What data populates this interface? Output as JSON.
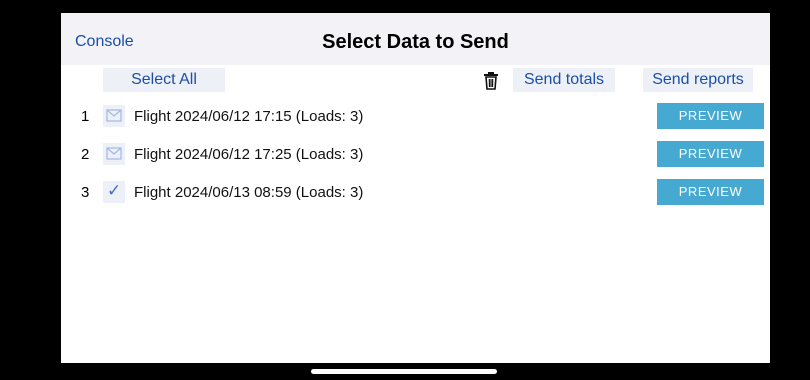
{
  "navbar": {
    "back_label": "Console",
    "title": "Select Data to Send"
  },
  "toolbar": {
    "select_all_label": "Select All",
    "delete_icon": "trash-icon",
    "send_totals_label": "Send totals",
    "send_reports_label": "Send reports"
  },
  "rows": [
    {
      "index": "1",
      "status": "envelope",
      "label": "Flight 2024/06/12 17:15 (Loads: 3)",
      "preview_label": "PREVIEW"
    },
    {
      "index": "2",
      "status": "envelope",
      "label": "Flight 2024/06/12 17:25 (Loads: 3)",
      "preview_label": "PREVIEW"
    },
    {
      "index": "3",
      "status": "checked",
      "label": "Flight 2024/06/13 08:59 (Loads: 3)",
      "preview_label": "PREVIEW"
    }
  ],
  "colors": {
    "accent": "#1a4fa8",
    "preview_button": "#46a9d2",
    "chip_background": "#eef0f7",
    "navbar_background": "#f2f2f7"
  }
}
